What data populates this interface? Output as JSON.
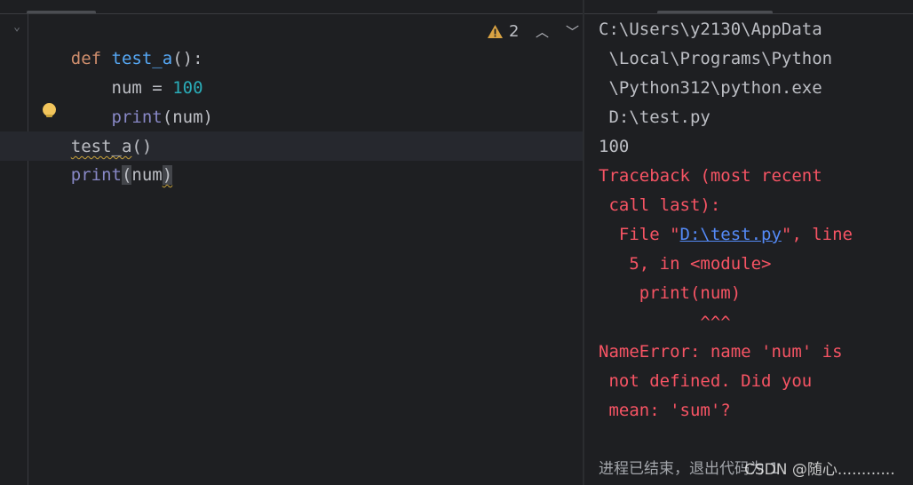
{
  "editor": {
    "lines": {
      "l1": {
        "kw": "def",
        "fn": "test_a",
        "rest": "():"
      },
      "l2": {
        "var": "num",
        "op": " = ",
        "num": "100"
      },
      "l3": {
        "builtin": "print",
        "open": "(",
        "arg": "num",
        "close": ")"
      },
      "l4": {
        "call": "test_a",
        "parens": "()"
      },
      "l5": {
        "builtin": "print",
        "open": "(",
        "arg": "num",
        "close": ")"
      }
    },
    "inspections": {
      "warning_count": "2",
      "warning_icon": "warning-triangle-icon",
      "prev_icon": "chevron-up-icon",
      "next_icon": "chevron-down-icon"
    },
    "fold_icon": "fold-chevron-icon",
    "intention_icon": "lightbulb-icon"
  },
  "console": {
    "cmd": [
      "C:\\Users\\y2130\\AppData",
      " \\Local\\Programs\\Python",
      " \\Python312\\python.exe",
      " D:\\test.py"
    ],
    "output": "100",
    "traceback": {
      "l1": "Traceback (most recent",
      "l2": " call last):",
      "file_prefix": "  File \"",
      "file_link": "D:\\test.py",
      "file_suffix": "\", line",
      "l4": "   5, in <module>",
      "l5": "    print(num)",
      "l6": "          ^^^",
      "l7": "NameError: name 'num' is",
      "l8": " not defined. Did you",
      "l9": " mean: 'sum'?"
    },
    "exit_message": "进程已结束，退出代码为 1"
  },
  "watermark": "CSDN @随心............",
  "colors": {
    "background": "#1e1f22",
    "keyword": "#cf8e6d",
    "function": "#56a8f5",
    "number": "#2aacb8",
    "builtin": "#8888c6",
    "text": "#bcbec4",
    "error": "#f75464",
    "link": "#548af7",
    "warning": "#d9a343"
  }
}
